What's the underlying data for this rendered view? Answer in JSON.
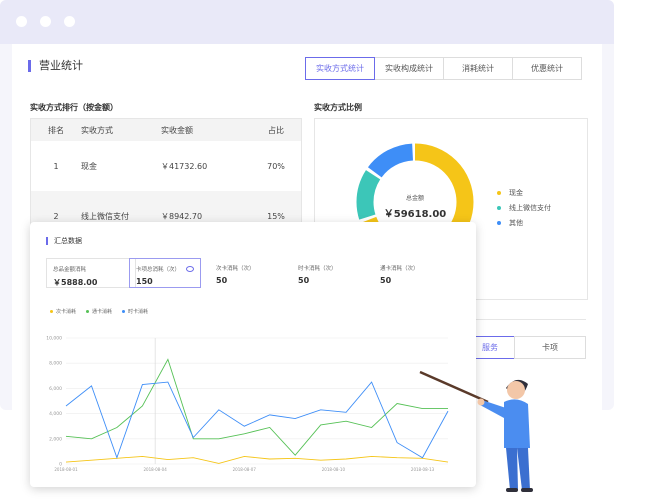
{
  "main": {
    "section_title": "营业统计",
    "tabs": [
      {
        "label": "实收方式统计",
        "active": true
      },
      {
        "label": "实收构成统计",
        "active": false
      },
      {
        "label": "消耗统计",
        "active": false
      },
      {
        "label": "优惠统计",
        "active": false
      }
    ],
    "ranking_title": "实收方式排行（按金额）",
    "ratio_title": "实收方式比例",
    "table": {
      "headers": [
        "排名",
        "实收方式",
        "实收金额",
        "占比"
      ],
      "rows": [
        {
          "rank": "1",
          "method": "现金",
          "amount": "￥41732.60",
          "ratio": "70%"
        },
        {
          "rank": "2",
          "method": "线上微信支付",
          "amount": "￥8942.70",
          "ratio": "15%"
        }
      ]
    },
    "donut": {
      "total_label": "总金额",
      "total_value": "￥59618.00",
      "segments": [
        {
          "name": "现金",
          "value": 70,
          "color": "#f5c518"
        },
        {
          "name": "线上微信支付",
          "value": 15,
          "color": "#3cc6b8"
        },
        {
          "name": "其他",
          "value": 15,
          "color": "#3e8ef7"
        }
      ]
    },
    "lower_tabs": {
      "active_label": "服务",
      "other_label": "卡项"
    }
  },
  "overlay": {
    "title": "汇总数据",
    "stats": [
      {
        "label": "总品金额消耗",
        "value": "￥5888.00"
      },
      {
        "label": "卡项总消耗（次）",
        "value": "150"
      },
      {
        "label": "次卡消耗（次）",
        "value": "50"
      },
      {
        "label": "时卡消耗（次）",
        "value": "50"
      },
      {
        "label": "通卡消耗（次）",
        "value": "50"
      }
    ]
  },
  "chart_data": {
    "type": "line",
    "ylim": [
      0,
      10000
    ],
    "yticks": [
      "0",
      "2,000",
      "4,000",
      "6,000",
      "8,000",
      "10,000"
    ],
    "x": [
      0,
      1,
      2,
      3,
      4,
      5,
      6,
      7,
      8,
      9,
      10,
      11,
      12,
      13,
      14,
      15
    ],
    "xticks": [
      {
        "x": 0,
        "label": "2018-08-01"
      },
      {
        "x": 3.5,
        "label": "2018-08-04"
      },
      {
        "x": 7,
        "label": "2018-08-07"
      },
      {
        "x": 10.5,
        "label": "2018-08-10"
      },
      {
        "x": 14,
        "label": "2018-08-13"
      }
    ],
    "highlight_x": 3.5,
    "series": [
      {
        "name": "次卡消耗",
        "color": "#f5c518",
        "values": [
          150,
          300,
          450,
          600,
          350,
          500,
          50,
          600,
          400,
          450,
          300,
          400,
          600,
          500,
          450,
          150
        ]
      },
      {
        "name": "通卡消耗",
        "color": "#56c156",
        "values": [
          2200,
          2000,
          2900,
          4600,
          8300,
          2000,
          2000,
          2400,
          2900,
          700,
          3100,
          3400,
          2900,
          4800,
          4400,
          4400
        ]
      },
      {
        "name": "时卡消耗",
        "color": "#3e8ef7",
        "values": [
          4600,
          6200,
          500,
          6300,
          6500,
          2100,
          4300,
          3000,
          3900,
          3600,
          4300,
          4100,
          6500,
          1700,
          500,
          4200
        ]
      }
    ]
  }
}
